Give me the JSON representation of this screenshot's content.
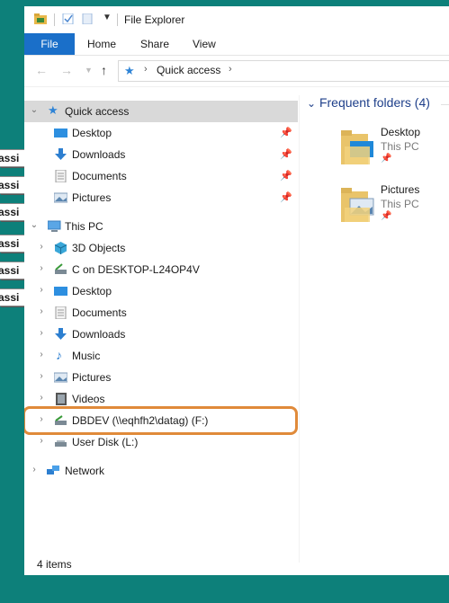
{
  "desktop": {
    "strip_labels": [
      "assi",
      "assi",
      "assi",
      "assi",
      "assi",
      "assi"
    ]
  },
  "window": {
    "title": "File Explorer",
    "ribbon_tabs": [
      "File",
      "Home",
      "Share",
      "View"
    ],
    "address": {
      "segment": "Quick access"
    },
    "nav": {
      "quick_access": {
        "label": "Quick access",
        "items": [
          "Desktop",
          "Downloads",
          "Documents",
          "Pictures"
        ]
      },
      "this_pc": {
        "label": "This PC",
        "items": [
          "3D Objects",
          "C on DESKTOP-L24OP4V",
          "Desktop",
          "Documents",
          "Downloads",
          "Music",
          "Pictures",
          "Videos",
          "DBDEV (\\\\eqhfh2\\datag) (F:)",
          "User Disk (L:)"
        ]
      },
      "network": {
        "label": "Network"
      }
    },
    "content": {
      "group_heading": "Frequent folders (4)",
      "tiles": [
        {
          "name": "Desktop",
          "location": "This PC"
        },
        {
          "name": "Pictures",
          "location": "This PC"
        }
      ]
    },
    "status": {
      "item_count": "4 items"
    }
  },
  "colors": {
    "desktop_bg": "#0d807a",
    "file_tab": "#1a6fc9",
    "highlight_outline": "#e08a3a",
    "selected_row": "#d9d9d9"
  }
}
